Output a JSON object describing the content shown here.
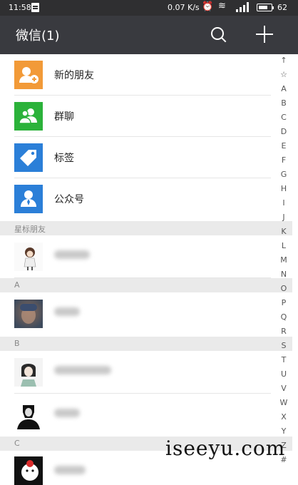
{
  "status_bar": {
    "time": "11:58",
    "speed": "0.07 K/s",
    "battery": "62"
  },
  "header": {
    "title": "微信(1)",
    "search_icon": "search-icon",
    "add_icon": "plus-icon"
  },
  "top_items": [
    {
      "label": "新的朋友",
      "icon": "add-friend-icon",
      "color": "#f29a38"
    },
    {
      "label": "群聊",
      "icon": "group-chat-icon",
      "color": "#2bb23a"
    },
    {
      "label": "标签",
      "icon": "tag-icon",
      "color": "#2b7fd8"
    },
    {
      "label": "公众号",
      "icon": "official-account-icon",
      "color": "#2b7fd8"
    }
  ],
  "sections": {
    "starred": "星标朋友",
    "a": "A",
    "b": "B",
    "c": "C"
  },
  "index_letters": [
    "↑",
    "☆",
    "A",
    "B",
    "C",
    "D",
    "E",
    "F",
    "G",
    "H",
    "I",
    "J",
    "K",
    "L",
    "M",
    "N",
    "O",
    "P",
    "Q",
    "R",
    "S",
    "T",
    "U",
    "V",
    "W",
    "X",
    "Y",
    "Z",
    "#"
  ],
  "watermark": "iseeyu.com"
}
